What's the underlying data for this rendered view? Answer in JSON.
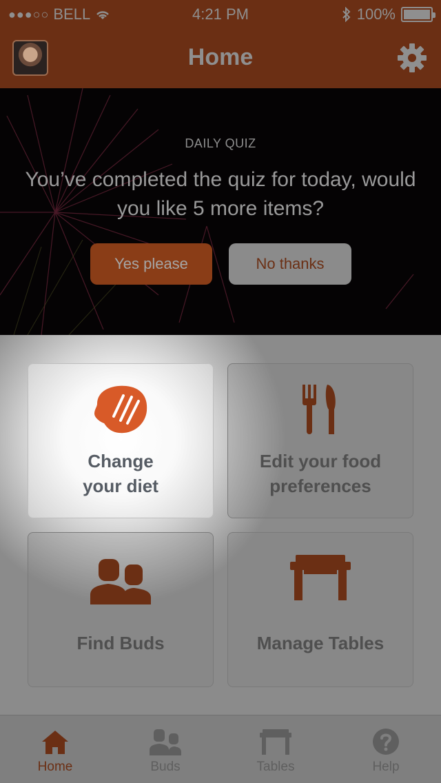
{
  "status_bar": {
    "carrier": "BELL",
    "time": "4:21 PM",
    "battery": "100%",
    "signal_dots": "●●●○○"
  },
  "nav": {
    "title": "Home",
    "avatar_icon": "user-avatar",
    "settings_icon": "gear-icon"
  },
  "quiz": {
    "label": "DAILY QUIZ",
    "message": "You’ve completed the quiz for today, would you like 5 more items?",
    "yes_label": "Yes please",
    "no_label": "No thanks"
  },
  "tiles": [
    {
      "label": "Change\nyour diet",
      "icon": "steak-icon"
    },
    {
      "label": "Edit your food\npreferences",
      "icon": "fork-knife-icon"
    },
    {
      "label": "Find Buds",
      "icon": "people-icon"
    },
    {
      "label": "Manage Tables",
      "icon": "table-icon"
    }
  ],
  "tabbar": {
    "items": [
      {
        "label": "Home",
        "icon": "home-icon",
        "active": true
      },
      {
        "label": "Buds",
        "icon": "people-icon",
        "active": false
      },
      {
        "label": "Tables",
        "icon": "table-icon",
        "active": false
      },
      {
        "label": "Help",
        "icon": "help-icon",
        "active": false
      }
    ]
  },
  "colors": {
    "brand": "#6b2f14",
    "accent_orange": "#d85a28",
    "overlay_gray": "#8b8b8b"
  }
}
